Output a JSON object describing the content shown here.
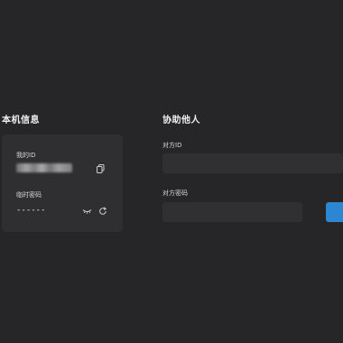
{
  "local": {
    "title": "本机信息",
    "my_id_label": "我的ID",
    "my_id_value": "",
    "temp_password_label": "临时密码",
    "temp_password_value": "------"
  },
  "help": {
    "title": "协助他人",
    "peer_id_label": "对方ID",
    "peer_id_value": "",
    "peer_id_placeholder": "",
    "peer_password_label": "对方密码",
    "peer_password_value": "",
    "peer_password_placeholder": "",
    "connect_label": ""
  },
  "colors": {
    "background": "#262628",
    "card": "#2f2f31",
    "input": "#303032",
    "accent": "#2d86d1"
  },
  "icons": {
    "copy": "copy-icon",
    "eye": "eye-closed-icon",
    "refresh": "refresh-icon"
  }
}
